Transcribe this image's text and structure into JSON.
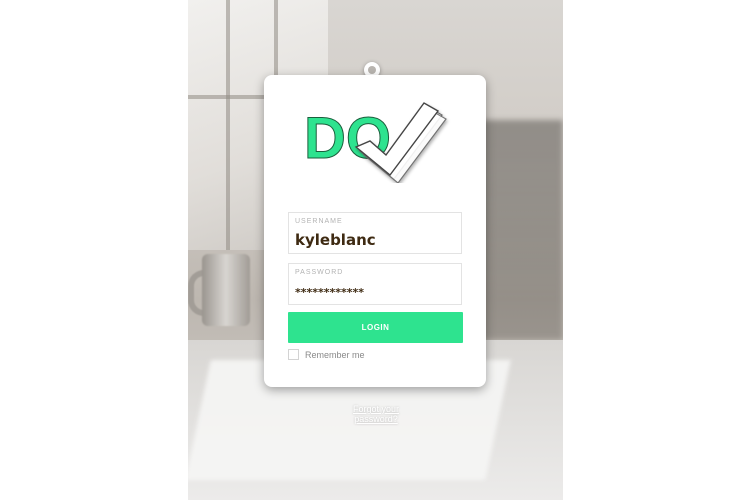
{
  "brand": {
    "logo_text": "DO",
    "accent": "#2ee38f"
  },
  "login_card": {
    "username": {
      "label": "USERNAME",
      "value": "kyleblanc"
    },
    "password": {
      "label": "PASSWORD",
      "value": "************"
    },
    "login_button": "LOGIN",
    "remember_me": {
      "label": "Remember me",
      "checked": false
    }
  },
  "forgot_password": "Forgot your password?"
}
